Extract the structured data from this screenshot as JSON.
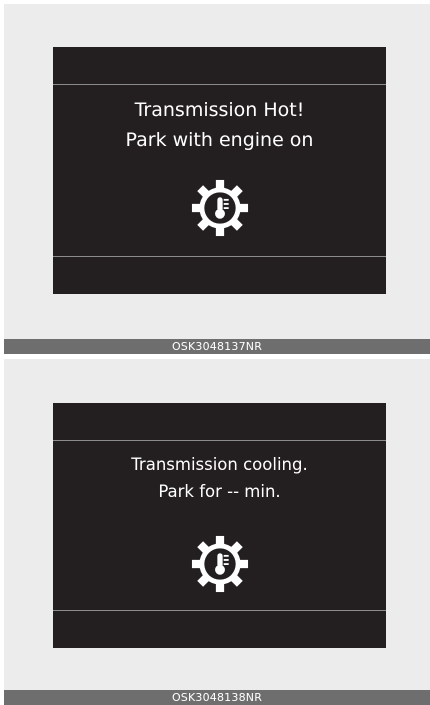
{
  "panels": [
    {
      "line1": "Transmission Hot!",
      "line2": "Park with engine on",
      "icon": "transmission-temperature-icon",
      "caption": "OSK3048137NR"
    },
    {
      "line1": "Transmission cooling.",
      "line2": "Park for -- min.",
      "icon": "transmission-temperature-icon",
      "caption": "OSK3048138NR"
    }
  ],
  "colors": {
    "screen": "#231f20",
    "panel": "#ececec",
    "caption_bar": "#6e6e6e",
    "text": "#ffffff"
  }
}
